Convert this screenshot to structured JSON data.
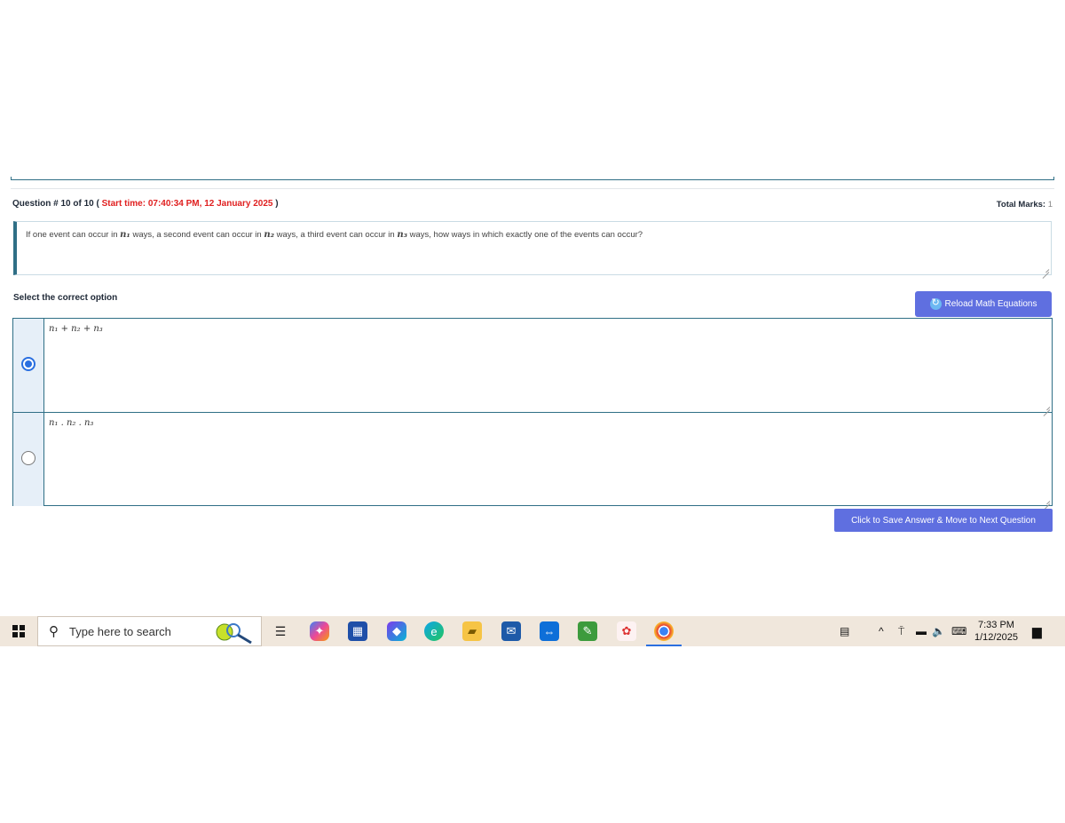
{
  "question": {
    "header_prefix": "Question # 10 of 10 (",
    "start_time": "Start time: 07:40:34 PM, 12 January 2025",
    "header_suffix": ")",
    "total_marks_label": "Total Marks:",
    "total_marks_value": "1",
    "text_part1": "If one event can occur in",
    "var1": "n₁",
    "text_part2": "ways, a second event can occur in",
    "var2": "n₂",
    "text_part3": "ways, a third event can occur in",
    "var3": "n₃",
    "text_part4": "ways, how ways in which exactly one of the events can occur?"
  },
  "options": {
    "select_label": "Select the correct option",
    "reload_label": "Reload Math Equations",
    "items": [
      {
        "text": "n₁ + n₂ + n₃",
        "selected": true
      },
      {
        "text": "n₁ . n₂ . n₃",
        "selected": false
      }
    ],
    "save_label": "Click to Save Answer & Move to Next Question"
  },
  "taskbar": {
    "search_placeholder": "Type here to search",
    "time": "7:33 PM",
    "date": "1/12/2025",
    "apps": [
      "task-view-icon",
      "copilot-icon",
      "store-icon",
      "m365-icon",
      "edge-icon",
      "file-explorer-icon",
      "mail-icon",
      "teamviewer-icon",
      "notepad-icon",
      "photo-icon",
      "chrome-icon"
    ],
    "colors": {
      "accent": "#5f6fe0",
      "start_time": "#e02020",
      "border": "#2f6f86"
    }
  }
}
